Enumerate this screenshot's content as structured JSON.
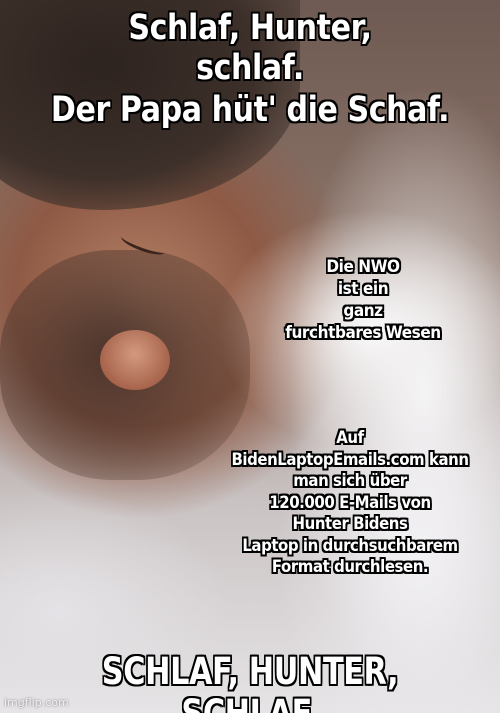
{
  "captions": {
    "top_line1": "Schlaf, Hunter,\nschlaf.",
    "top_line2": "Der Papa hüt' die Schaf.",
    "side_1": "Die NWO\nist ein\nganz\nfurchtbares Wesen",
    "side_2": "Auf\nBidenLaptopEmails.com kann\nman sich über\n120.000 E-Mails von\nHunter Bidens\nLaptop in durchsuchbarem\nFormat durchlesen.",
    "bottom": "SCHLAF, HUNTER, SCHLAF."
  },
  "watermark": "imgflip.com"
}
